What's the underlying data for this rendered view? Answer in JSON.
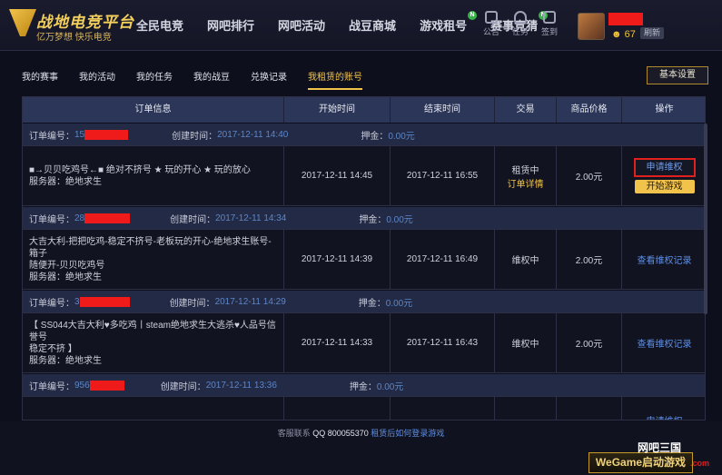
{
  "header": {
    "logo_title": "战地电竞平台",
    "logo_sub": "亿万梦想  快乐电竞",
    "nav": [
      {
        "label": "全民电竞",
        "badge": ""
      },
      {
        "label": "网吧排行",
        "badge": ""
      },
      {
        "label": "网吧活动",
        "badge": ""
      },
      {
        "label": "战豆商城",
        "badge": ""
      },
      {
        "label": "游戏租号",
        "badge": "N"
      },
      {
        "label": "赛事竞猜",
        "badge": "N"
      }
    ],
    "tools": [
      {
        "label": "公告",
        "icon": "announcement-icon"
      },
      {
        "label": "任务",
        "icon": "task-icon"
      },
      {
        "label": "签到",
        "icon": "checkin-icon"
      }
    ],
    "coin_count": "67",
    "refresh_label": "刷新"
  },
  "tabs": [
    {
      "label": "我的赛事",
      "active": false
    },
    {
      "label": "我的活动",
      "active": false
    },
    {
      "label": "我的任务",
      "active": false
    },
    {
      "label": "我的战豆",
      "active": false
    },
    {
      "label": "兑换记录",
      "active": false
    },
    {
      "label": "我租赁的账号",
      "active": true
    }
  ],
  "settings_label": "基本设置",
  "table": {
    "columns": [
      "订单信息",
      "开始时间",
      "结束时间",
      "交易",
      "商品价格",
      "操作"
    ],
    "labels": {
      "order_no": "订单编号：",
      "created": "创建时间：",
      "deposit": "押金："
    },
    "orders": [
      {
        "order_no_prefix": "15",
        "created": "2017-12-11 14:40",
        "deposit": "0.00元",
        "info_line1": "■→贝贝吃鸡号←■ 绝对不挤号 ★ 玩的开心 ★ 玩的放心",
        "info_line2": "",
        "server": "服务器：绝地求生",
        "start": "2017-12-11 14:45",
        "end": "2017-12-11 16:55",
        "status": "租赁中",
        "status_link": "订单详情",
        "price": "2.00元",
        "op_primary": "申请维权",
        "op_secondary": "开始游戏"
      },
      {
        "order_no_prefix": "28",
        "created": "2017-12-11 14:34",
        "deposit": "0.00元",
        "info_line1": "大吉大利-把把吃鸡-稳定不挤号-老板玩的开心-绝地求生账号-箱子",
        "info_line2": "随便开-贝贝吃鸡号",
        "server": "服务器：绝地求生",
        "start": "2017-12-11 14:39",
        "end": "2017-12-11 16:49",
        "status": "维权中",
        "status_link": "",
        "price": "2.00元",
        "op_primary": "查看维权记录",
        "op_secondary": ""
      },
      {
        "order_no_prefix": "3",
        "created": "2017-12-11 14:29",
        "deposit": "0.00元",
        "info_line1": "【 SS044大吉大利♥多吃鸡丨steam绝地求生大逃杀♥人品号信誉号",
        "info_line2": "稳定不挤 】",
        "server": "服务器：绝地求生",
        "start": "2017-12-11 14:33",
        "end": "2017-12-11 16:43",
        "status": "维权中",
        "status_link": "",
        "price": "2.00元",
        "op_primary": "查看维权记录",
        "op_secondary": ""
      },
      {
        "order_no_prefix": "956",
        "created": "2017-12-11 13:36",
        "deposit": "0.00元",
        "info_line1": "",
        "info_line2": "",
        "server": "",
        "start": "",
        "end": "",
        "status": "",
        "status_link": "",
        "price": "",
        "op_primary": "申请维权",
        "op_secondary": ""
      }
    ]
  },
  "footer": {
    "support_prefix": "客服联系 ",
    "support_qq": "QQ 800055370",
    "support_link": "租赁后如何登录游戏",
    "wegame_label": "WeGame启动游戏",
    "watermark": "网吧三国",
    "watermark_url": ".com"
  }
}
